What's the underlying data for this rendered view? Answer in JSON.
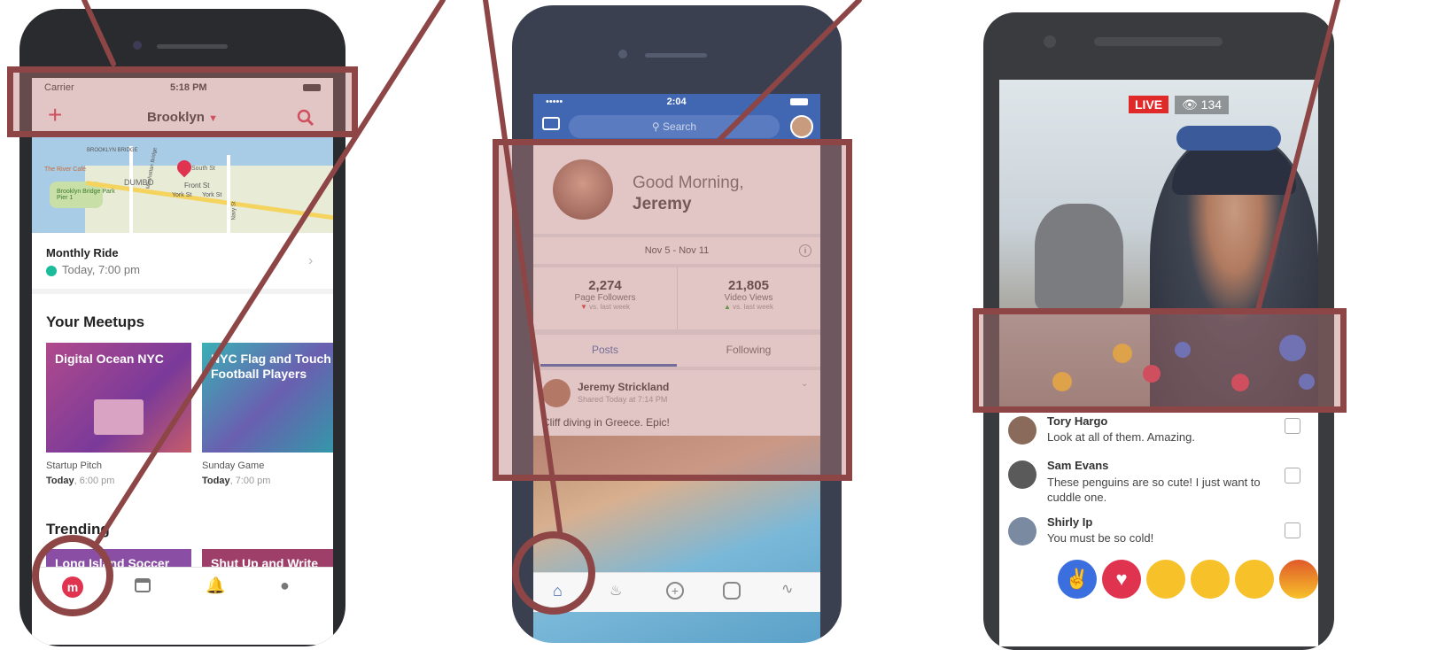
{
  "colors": {
    "annotation": "#8e4545",
    "meetup_red": "#e0334f",
    "fb_blue": "#4267b2",
    "live_red": "#e02a2a"
  },
  "meetup": {
    "carrier": "Carrier",
    "time": "5:18 PM",
    "location": "Brooklyn",
    "map_labels": [
      "BROOKLYN BRIDGE",
      "The River Café",
      "DUMBO",
      "South St",
      "Front St",
      "York St",
      "York St",
      "Brooklyn Bridge Park Pier 1",
      "Navy St",
      "Manhattan Bridge"
    ],
    "event": {
      "title": "Monthly Ride",
      "when": "Today, 7:00 pm"
    },
    "section_title": "Your Meetups",
    "cards": [
      {
        "name": "Digital Ocean NYC",
        "subtitle": "Startup Pitch",
        "day": "Today",
        "time": ", 6:00 pm"
      },
      {
        "name": "NYC Flag and Touch Football Players",
        "subtitle": "Sunday Game",
        "day": "Today",
        "time": ", 7:00 pm"
      }
    ],
    "trending_title": "Trending",
    "trending": [
      "Long Island Soccer",
      "Shut Up and Write"
    ],
    "tabs": [
      "meetup-logo-icon",
      "calendar-icon",
      "bell-icon",
      "person-icon"
    ]
  },
  "facebook": {
    "time": "2:04",
    "search_placeholder": "Search",
    "greeting": "Good Morning,",
    "name": "Jeremy",
    "date_range": "Nov 5 - Nov 11",
    "stats": [
      {
        "value": "2,274",
        "label": "Page Followers",
        "delta": "vs. last week"
      },
      {
        "value": "21,805",
        "label": "Video Views",
        "delta": "vs. last week"
      }
    ],
    "tabs": [
      "Posts",
      "Following"
    ],
    "post": {
      "author": "Jeremy Strickland",
      "meta": "Shared Today at 7:14 PM",
      "text": "Cliff diving in Greece. Epic!"
    },
    "nav": [
      "home-icon",
      "bell-icon",
      "plus-circle-icon",
      "profile-icon",
      "activity-icon"
    ]
  },
  "live": {
    "badge": "LIVE",
    "viewers": "134",
    "comments": [
      {
        "name": "Tory Hargo",
        "text": "Look at all of them. Amazing."
      },
      {
        "name": "Sam Evans",
        "text": "These penguins are so cute! I just want to cuddle one."
      },
      {
        "name": "Shirly Ip",
        "text": "You must be so cold!"
      }
    ],
    "reactions": [
      "like-icon",
      "love-icon",
      "haha-icon",
      "wow-icon",
      "sad-icon",
      "angry-icon"
    ]
  }
}
